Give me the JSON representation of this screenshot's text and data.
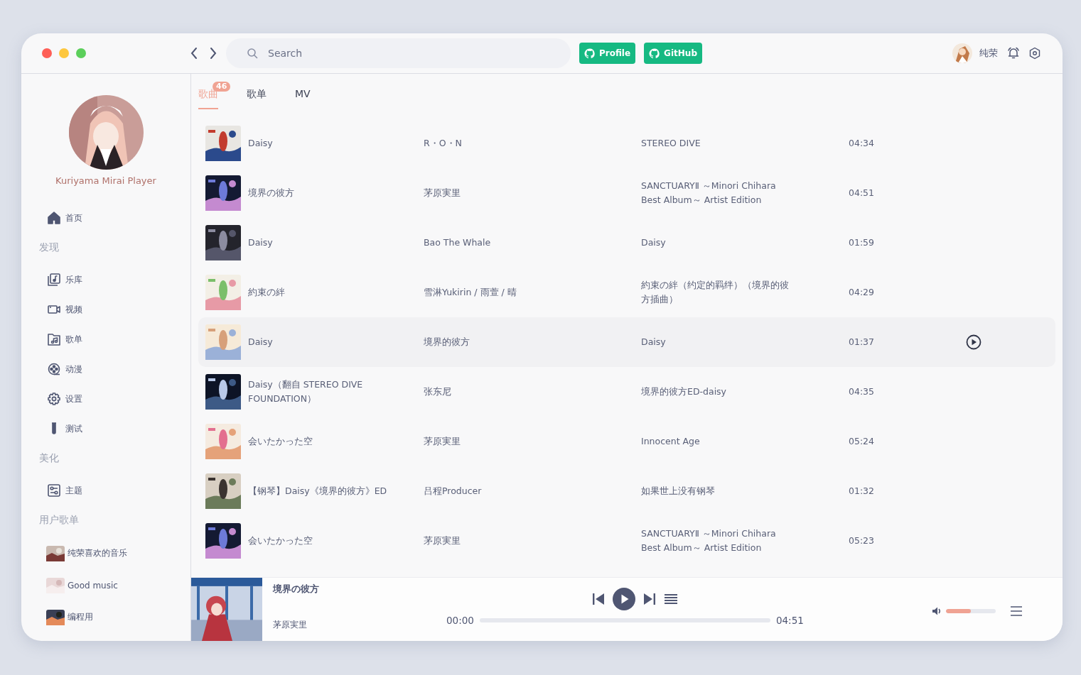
{
  "window_controls": [
    {
      "color": "#fe5f57"
    },
    {
      "color": "#fdc73f"
    },
    {
      "color": "#5ccf5b"
    }
  ],
  "header": {
    "search": {
      "placeholder": "Search"
    },
    "links": [
      {
        "label": "Profile"
      },
      {
        "label": "GitHub"
      }
    ],
    "user": {
      "name": "纯荣"
    }
  },
  "sidebar": {
    "app_name": "Kuriyama Mirai Player",
    "items": [
      {
        "kind": "link",
        "label": "首页"
      },
      {
        "kind": "heading",
        "label": "发现"
      },
      {
        "kind": "link",
        "label": "乐库"
      },
      {
        "kind": "link",
        "label": "视频"
      },
      {
        "kind": "link",
        "label": "歌单"
      },
      {
        "kind": "link",
        "label": "动漫"
      },
      {
        "kind": "link",
        "label": "设置"
      },
      {
        "kind": "link",
        "label": "测试"
      },
      {
        "kind": "heading",
        "label": "美化"
      },
      {
        "kind": "link",
        "label": "主题"
      },
      {
        "kind": "heading",
        "label": "用户歌单"
      },
      {
        "kind": "playlist",
        "label": "纯荣喜欢的音乐"
      },
      {
        "kind": "playlist",
        "label": "Good music"
      },
      {
        "kind": "playlist",
        "label": "编程用"
      }
    ]
  },
  "tabs": [
    {
      "label": "歌曲",
      "selected": true,
      "badge": "46"
    },
    {
      "label": "歌单",
      "selected": false
    },
    {
      "label": "MV",
      "selected": false
    }
  ],
  "songs": [
    {
      "title": "Daisy",
      "artist": "R・O・N",
      "album": "STEREO DIVE",
      "duration": "04:34",
      "hovered": false
    },
    {
      "title": "境界の彼方",
      "artist": "茅原実里",
      "album": "SANCTUARYⅡ ～Minori Chihara Best Album～ Artist Edition",
      "duration": "04:51",
      "hovered": false
    },
    {
      "title": "Daisy",
      "artist": "Bao The Whale",
      "album": "Daisy",
      "duration": "01:59",
      "hovered": false
    },
    {
      "title": "約束の絆",
      "artist": "雪淋Yukirin / 雨萱 / 晴",
      "album": "約束の絆（约定的羁绊）（境界的彼方插曲）",
      "duration": "04:29",
      "hovered": false
    },
    {
      "title": "Daisy",
      "artist": "境界的彼方",
      "album": "Daisy",
      "duration": "01:37",
      "hovered": true
    },
    {
      "title": "Daisy（翻自 STEREO DIVE FOUNDATION）",
      "artist": "张东尼",
      "album": "境界的彼方ED-daisy",
      "duration": "04:35",
      "hovered": false
    },
    {
      "title": "会いたかった空",
      "artist": "茅原実里",
      "album": "Innocent Age",
      "duration": "05:24",
      "hovered": false
    },
    {
      "title": "【钢琴】Daisy《境界的彼方》ED",
      "artist": "吕程Producer",
      "album": "如果世上没有钢琴",
      "duration": "01:32",
      "hovered": false
    },
    {
      "title": "会いたかった空",
      "artist": "茅原実里",
      "album": "SANCTUARYⅡ ～Minori Chihara Best Album～ Artist Edition",
      "duration": "05:23",
      "hovered": false
    }
  ],
  "player": {
    "title": "境界の彼方",
    "artist": "茅原実里",
    "elapsed": "00:00",
    "total": "04:51",
    "progress": {
      "level": 0
    },
    "volume": {
      "level": 0.5
    }
  }
}
